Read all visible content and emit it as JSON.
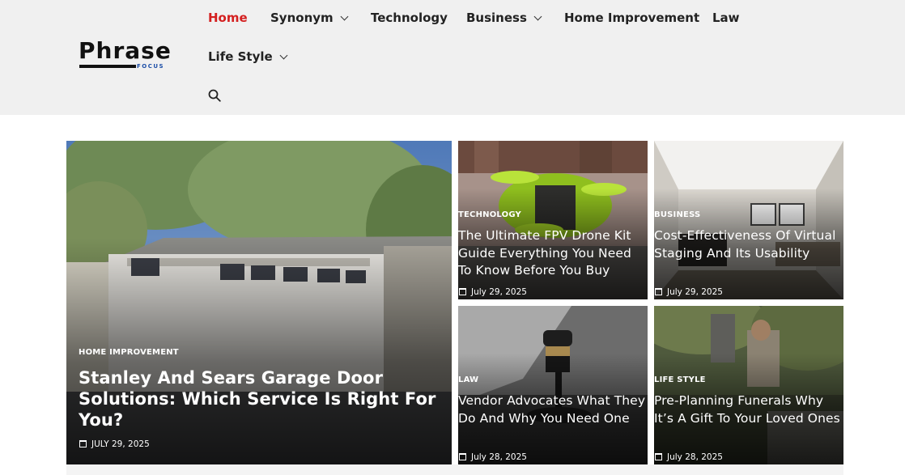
{
  "logo": {
    "word": "Phrase",
    "sub": "FOCUS"
  },
  "nav": {
    "home": "Home",
    "synonym": "Synonym",
    "technology": "Technology",
    "business": "Business",
    "home_improvement": "Home Improvement",
    "law": "Law",
    "life_style": "Life Style",
    "active_color": "#d41f1f"
  },
  "icons": {
    "search": "search-icon",
    "calendar": "calendar-icon",
    "dropdown": "chevron-down-icon"
  },
  "posts": [
    {
      "category": "HOME IMPROVEMENT",
      "title": "Stanley And Sears Garage Door Solutions: Which Service Is Right For You?",
      "date": "JULY 29, 2025"
    },
    {
      "category": "TECHNOLOGY",
      "title": "The Ultimate FPV Drone Kit Guide Everything You Need To Know Before You Buy",
      "date": "July 29, 2025"
    },
    {
      "category": "BUSINESS",
      "title": "Cost-Effectiveness Of Virtual Staging And Its Usability",
      "date": "July 29, 2025"
    },
    {
      "category": "LAW",
      "title": "Vendor Advocates What They Do And Why You Need One",
      "date": "July 28, 2025"
    },
    {
      "category": "LIFE STYLE",
      "title": "Pre-Planning Funerals Why It’s A Gift To Your Loved Ones",
      "date": "July 28, 2025"
    }
  ]
}
